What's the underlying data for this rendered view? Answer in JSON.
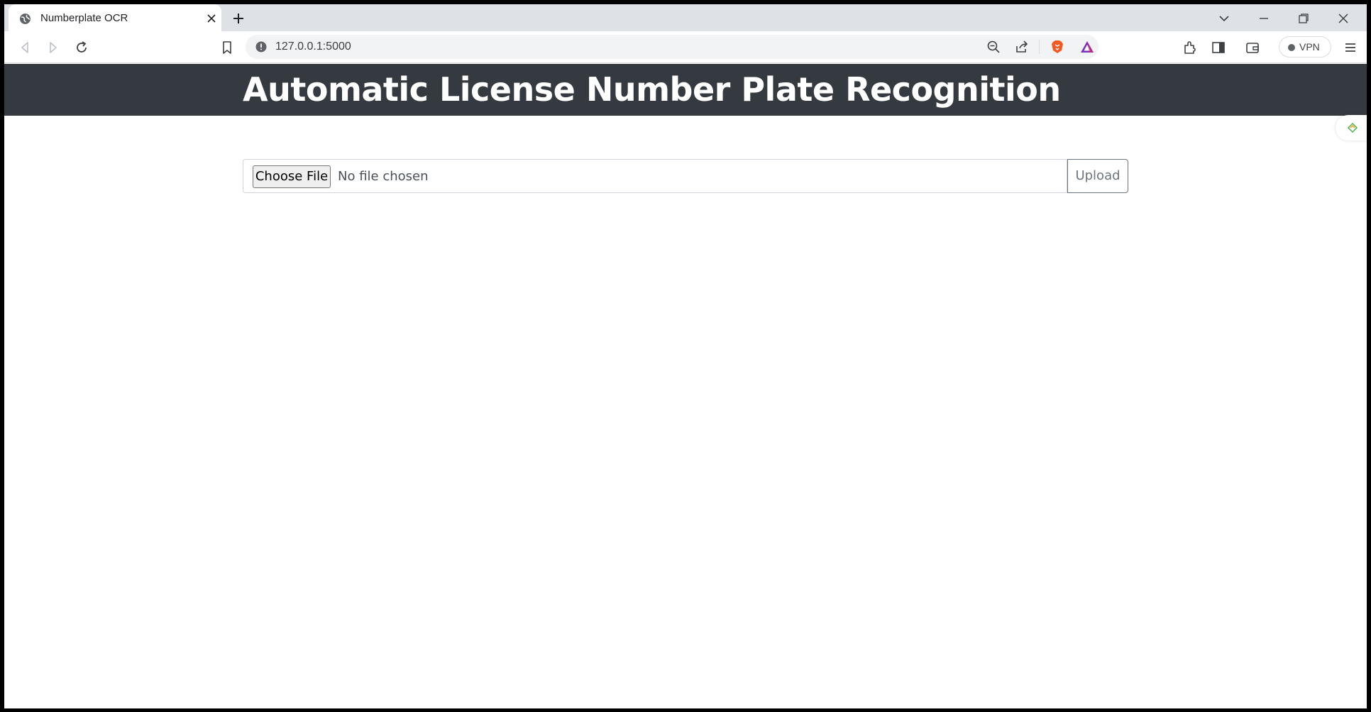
{
  "browser": {
    "tab": {
      "title": "Numberplate OCR",
      "favicon": "globe-icon"
    },
    "address_bar": {
      "url": "127.0.0.1:5000",
      "security_icon": "info-icon"
    },
    "vpn_label": "VPN",
    "colors": {
      "tabstrip": "#dee1e6",
      "brave_orange": "#f15a22",
      "rewards_purple": "#7b2fbe"
    }
  },
  "page": {
    "header": {
      "title": "Automatic License Number Plate Recognition"
    },
    "upload_form": {
      "choose_file_label": "Choose File",
      "file_status": "No file chosen",
      "upload_label": "Upload"
    },
    "colors": {
      "navbar_bg": "#343a40",
      "navbar_text": "#ffffff",
      "upload_border": "#6c757d"
    }
  }
}
